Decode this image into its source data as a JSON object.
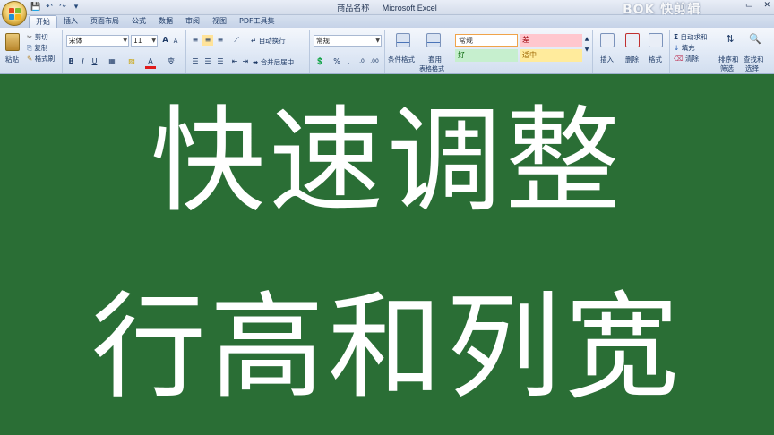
{
  "titlebar": {
    "doc_name": "商品名称",
    "app_name": "Microsoft Excel",
    "watermark": "BOK 快剪辑",
    "qat": [
      "save-icon",
      "undo-icon",
      "redo-icon",
      "customize-icon"
    ],
    "controls": [
      "▭",
      "✕"
    ]
  },
  "tabs": [
    "开始",
    "插入",
    "页面布局",
    "公式",
    "数据",
    "审阅",
    "视图",
    "PDF工具集"
  ],
  "ribbon": {
    "clipboard": {
      "paste": "粘贴",
      "cut": "剪切",
      "copy": "复制",
      "format_painter": "格式刷"
    },
    "font": {
      "name": "宋体",
      "size": "11",
      "bold": "B",
      "italic": "I",
      "underline": "U",
      "grow": "A",
      "shrink": "A",
      "font_color": "A",
      "phonetic": "变"
    },
    "alignment": {
      "wrap": "自动换行",
      "merge": "合并后居中"
    },
    "number": {
      "format": "常规",
      "percent": "%",
      "comma": ","
    },
    "styles": {
      "conditional": "条件格式",
      "table": "套用",
      "table2": "表格格式",
      "normal": "常规",
      "bad": "差",
      "good": "好",
      "neutral": "适中"
    },
    "cells": {
      "insert": "插入",
      "delete": "删除",
      "format": "格式"
    },
    "editing": {
      "autosum": "自动求和",
      "fill": "填充",
      "clear": "清除",
      "sort": "排序和",
      "sort2": "筛选",
      "find": "查找和",
      "find2": "选择"
    }
  },
  "content": {
    "line1": "快速调整",
    "line2": "行高和列宽"
  },
  "colors": {
    "background": "#2a6e35",
    "text": "#ffffff",
    "style_normal_bg": "#ffffff",
    "style_bad_bg": "#ffc7ce",
    "style_good_bg": "#c6efce",
    "style_neutral_bg": "#ffeb9c"
  }
}
